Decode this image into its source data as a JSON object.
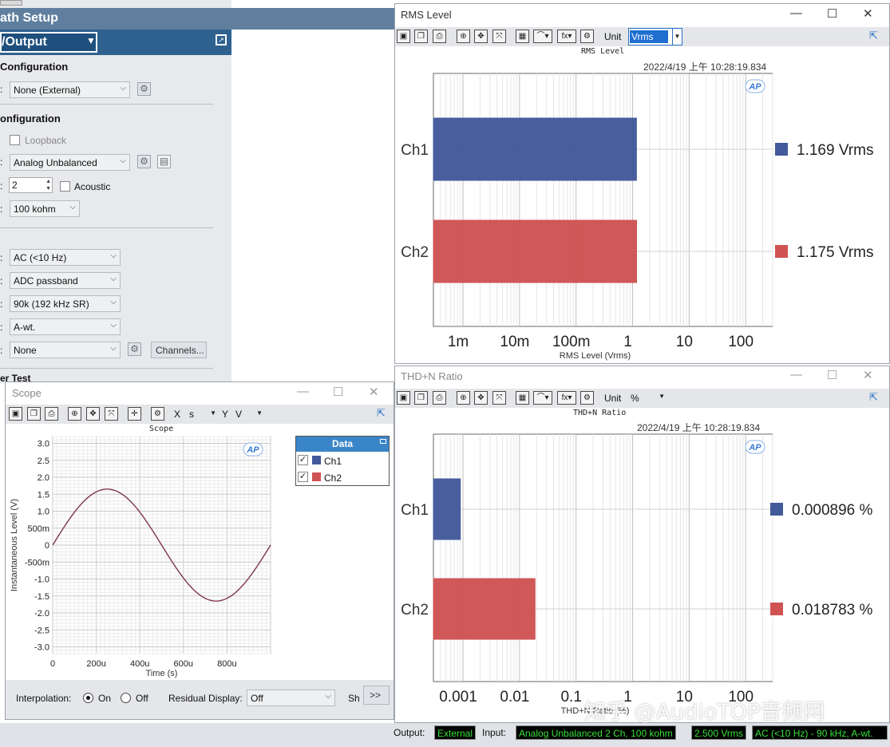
{
  "path_setup": {
    "title": "ath Setup",
    "io_select": "/Output",
    "output_config_head": "Configuration",
    "output_config_value": "None (External)",
    "input_config_head": "onfiguration",
    "loopback_label": "Loopback",
    "connector_value": "Analog Unbalanced",
    "channels_value": "2",
    "acoustic_label": "Acoustic",
    "impedance_value": "100 kohm",
    "coupling_value": "AC (<10 Hz)",
    "bandwidth_value": "ADC passband",
    "bw_limit_value": "90k (192 kHz SR)",
    "weighting_value": "A-wt.",
    "filter_value": "None",
    "channels_button": "Channels...",
    "partial_test_head": "er Test"
  },
  "rms_window": {
    "title": "RMS Level",
    "unit_label": "Unit",
    "unit_value": "Vrms",
    "chart_title": "RMS Level",
    "timestamp": "2022/4/19 上午 10:28:19.834",
    "logo": "AP",
    "xlabel": "RMS Level (Vrms)",
    "xticks": [
      "1m",
      "10m",
      "100m",
      "1",
      "10",
      "100"
    ],
    "channels": [
      "Ch1",
      "Ch2"
    ],
    "readouts": [
      "1.169  Vrms",
      "1.175  Vrms"
    ]
  },
  "thd_window": {
    "title": "THD+N Ratio",
    "unit_label": "Unit",
    "unit_value": "%",
    "chart_title": "THD+N Ratio",
    "timestamp": "2022/4/19 上午 10:28:19.834",
    "logo": "AP",
    "xlabel": "THD+N Ratio (%)",
    "xticks": [
      "0.001",
      "0.01",
      "0.1",
      "1",
      "10",
      "100"
    ],
    "channels": [
      "Ch1",
      "Ch2"
    ],
    "readouts": [
      "0.000896  %",
      "0.018783  %"
    ]
  },
  "scope_window": {
    "title": "Scope",
    "x_label": "X",
    "x_unit": "s",
    "y_label": "Y",
    "y_unit": "V",
    "chart_title": "Scope",
    "logo": "AP",
    "ylabel": "Instantaneous Level (V)",
    "xlabel": "Time (s)",
    "yticks": [
      "3.0",
      "2.5",
      "2.0",
      "1.5",
      "1.0",
      "500m",
      "0",
      "-500m",
      "-1.0",
      "-1.5",
      "-2.0",
      "-2.5",
      "-3.0"
    ],
    "xticks": [
      "0",
      "200u",
      "400u",
      "600u",
      "800u"
    ],
    "legend_title": "Data",
    "legend_items": [
      "Ch1",
      "Ch2"
    ],
    "interpolation_label": "Interpolation:",
    "on_label": "On",
    "off_label": "Off",
    "residual_label": "Residual Display:",
    "residual_value": "Off",
    "sh_label": "Sh",
    "more_button": ">>"
  },
  "status_bar": {
    "output_label": "Output:",
    "output_value": "External",
    "input_label": "Input:",
    "input_value": "Analog Unbalanced 2 Ch, 100 kohm",
    "level_value": "2.500 Vrms",
    "filter_value": "AC (<10 Hz) - 90 kHz, A-wt."
  },
  "watermark": "知乎 @AudioTOP音频网",
  "colors": {
    "ch1": "#435a9a",
    "ch2": "#d05353",
    "scope_trace": "#8a3a4a",
    "status_text": "#38e038"
  },
  "chart_data": [
    {
      "type": "bar",
      "title": "RMS Level",
      "categories": [
        "Ch1",
        "Ch2"
      ],
      "values": [
        1.169,
        1.175
      ],
      "xlabel": "RMS Level (Vrms)",
      "scale": "log",
      "xlim": [
        0.0003,
        300
      ]
    },
    {
      "type": "bar",
      "title": "THD+N Ratio",
      "categories": [
        "Ch1",
        "Ch2"
      ],
      "values": [
        0.000896,
        0.018783
      ],
      "xlabel": "THD+N Ratio (%)",
      "scale": "log",
      "xlim": [
        0.0003,
        300
      ]
    },
    {
      "type": "line",
      "title": "Scope",
      "xlabel": "Time (s)",
      "ylabel": "Instantaneous Level (V)",
      "xlim": [
        0,
        0.001
      ],
      "ylim": [
        -3.2,
        3.2
      ],
      "series": [
        {
          "name": "Ch1",
          "x": [
            0,
            0.0001,
            0.0002,
            0.00025,
            0.0003,
            0.0004,
            0.0005,
            0.0006,
            0.0007,
            0.00075,
            0.0008,
            0.0009,
            0.001
          ],
          "y": [
            0,
            0.97,
            1.57,
            1.65,
            1.57,
            0.97,
            0,
            -0.97,
            -1.57,
            -1.65,
            -1.57,
            -0.97,
            0
          ]
        },
        {
          "name": "Ch2",
          "x": [
            0,
            0.0001,
            0.0002,
            0.00025,
            0.0003,
            0.0004,
            0.0005,
            0.0006,
            0.0007,
            0.00075,
            0.0008,
            0.0009,
            0.001
          ],
          "y": [
            0,
            0.97,
            1.57,
            1.65,
            1.57,
            0.97,
            0,
            -0.97,
            -1.57,
            -1.65,
            -1.57,
            -0.97,
            0
          ]
        }
      ]
    }
  ]
}
